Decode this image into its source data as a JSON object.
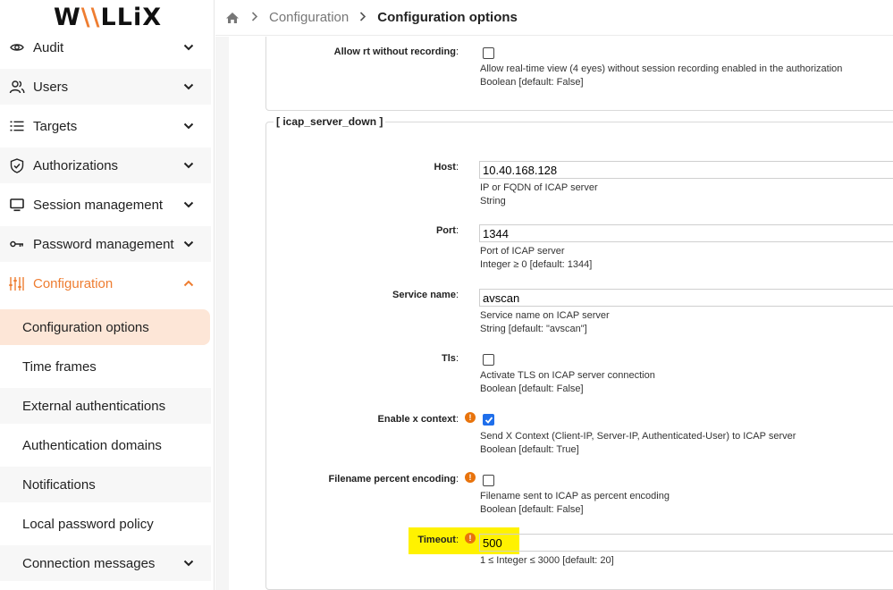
{
  "brand": {
    "logo_text_1": "W",
    "logo_text_2": "\\\\",
    "logo_text_3": "LLiX"
  },
  "sidebar": {
    "items": [
      {
        "label": "Audit",
        "icon": "eye-icon"
      },
      {
        "label": "Users",
        "icon": "users-icon"
      },
      {
        "label": "Targets",
        "icon": "list-icon"
      },
      {
        "label": "Authorizations",
        "icon": "shield-check-icon"
      },
      {
        "label": "Session management",
        "icon": "monitor-icon"
      },
      {
        "label": "Password management",
        "icon": "key-icon"
      },
      {
        "label": "Configuration",
        "icon": "sliders-icon"
      }
    ],
    "sub_items": [
      {
        "label": "Configuration options"
      },
      {
        "label": "Time frames"
      },
      {
        "label": "External authentications"
      },
      {
        "label": "Authentication domains"
      },
      {
        "label": "Notifications"
      },
      {
        "label": "Local password policy"
      },
      {
        "label": "Connection messages"
      }
    ]
  },
  "breadcrumb": {
    "items": [
      "Configuration",
      "Configuration options"
    ]
  },
  "section_top": {
    "allow_rt": {
      "label": "Allow rt without recording",
      "checked": false,
      "desc": "Allow real-time view (4 eyes) without session recording enabled in the authorization",
      "type": "Boolean [default: False]"
    }
  },
  "icap": {
    "legend": "[ icap_server_down ]",
    "host": {
      "label": "Host",
      "value": "10.40.168.128",
      "desc": "IP or FQDN of ICAP server",
      "type": "String"
    },
    "port": {
      "label": "Port",
      "value": "1344",
      "desc": "Port of ICAP server",
      "type": "Integer ≥ 0 [default: 1344]"
    },
    "service_name": {
      "label": "Service name",
      "value": "avscan",
      "desc": "Service name on ICAP server",
      "type": "String [default: \"avscan\"]"
    },
    "tls": {
      "label": "Tls",
      "checked": false,
      "desc": "Activate TLS on ICAP server connection",
      "type": "Boolean [default: False]"
    },
    "enable_x_context": {
      "label": "Enable x context",
      "checked": true,
      "desc": "Send X Context (Client-IP, Server-IP, Authenticated-User) to ICAP server",
      "type": "Boolean [default: True]"
    },
    "filename_percent": {
      "label": "Filename percent encoding",
      "checked": false,
      "desc": "Filename sent to ICAP as percent encoding",
      "type": "Boolean [default: False]"
    },
    "timeout": {
      "label": "Timeout",
      "value": "500",
      "type": "1 ≤ Integer ≤ 3000 [default: 20]"
    }
  },
  "colors": {
    "accent": "#ee7d31",
    "selected_bg": "#fde6d7",
    "highlight": "#fff200",
    "warn": "#e8730c",
    "check": "#1f6feb"
  },
  "warn_glyph": "!",
  "colon": ":"
}
